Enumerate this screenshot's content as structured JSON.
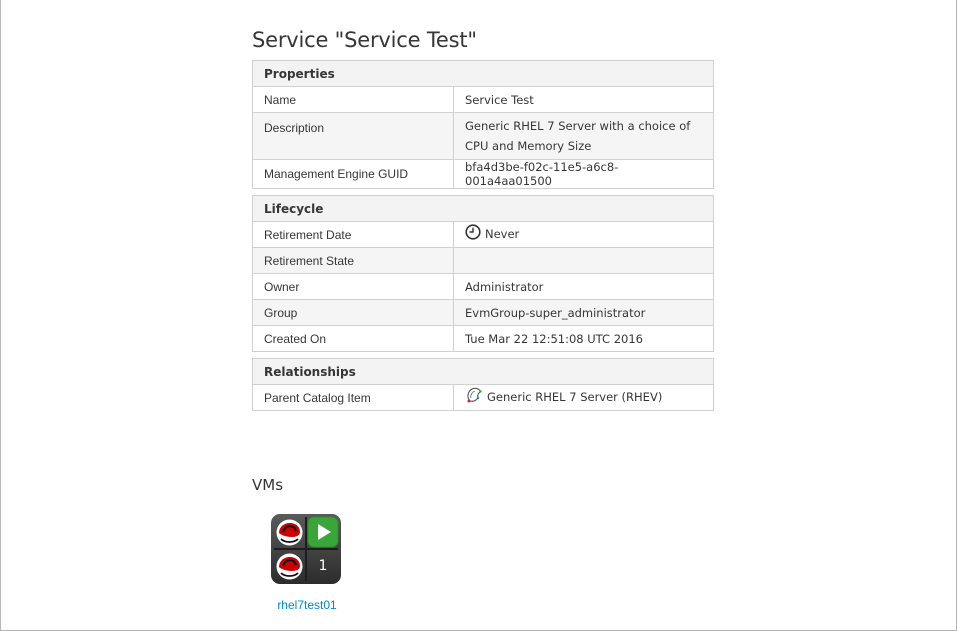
{
  "page": {
    "title": "Service \"Service Test\""
  },
  "properties": {
    "header": "Properties",
    "rows": [
      {
        "label": "Name",
        "value": "Service Test"
      },
      {
        "label": "Description",
        "value": "Generic RHEL 7 Server with a choice of CPU and Memory Size"
      },
      {
        "label": "Management Engine GUID",
        "value": "bfa4d3be-f02c-11e5-a6c8-001a4aa01500"
      }
    ]
  },
  "lifecycle": {
    "header": "Lifecycle",
    "rows": [
      {
        "label": "Retirement Date",
        "value": "Never",
        "icon": "clock-icon"
      },
      {
        "label": "Retirement State",
        "value": ""
      },
      {
        "label": "Owner",
        "value": "Administrator"
      },
      {
        "label": "Group",
        "value": "EvmGroup-super_administrator"
      },
      {
        "label": "Created On",
        "value": "Tue Mar 22 12:51:08 UTC 2016"
      }
    ]
  },
  "relationships": {
    "header": "Relationships",
    "rows": [
      {
        "label": "Parent Catalog Item",
        "value": "Generic RHEL 7 Server (RHEV)",
        "icon": "catalog-item-icon"
      }
    ]
  },
  "vms": {
    "heading": "VMs",
    "items": [
      {
        "name": "rhel7test01",
        "power_state": "on",
        "snapshot_count": "1",
        "os": "redhat-logo"
      }
    ]
  },
  "colors": {
    "link": "#0088ce",
    "header_bg": "#f3f3f3",
    "border": "#d1d1d1",
    "power_on": "#3aa63a"
  }
}
